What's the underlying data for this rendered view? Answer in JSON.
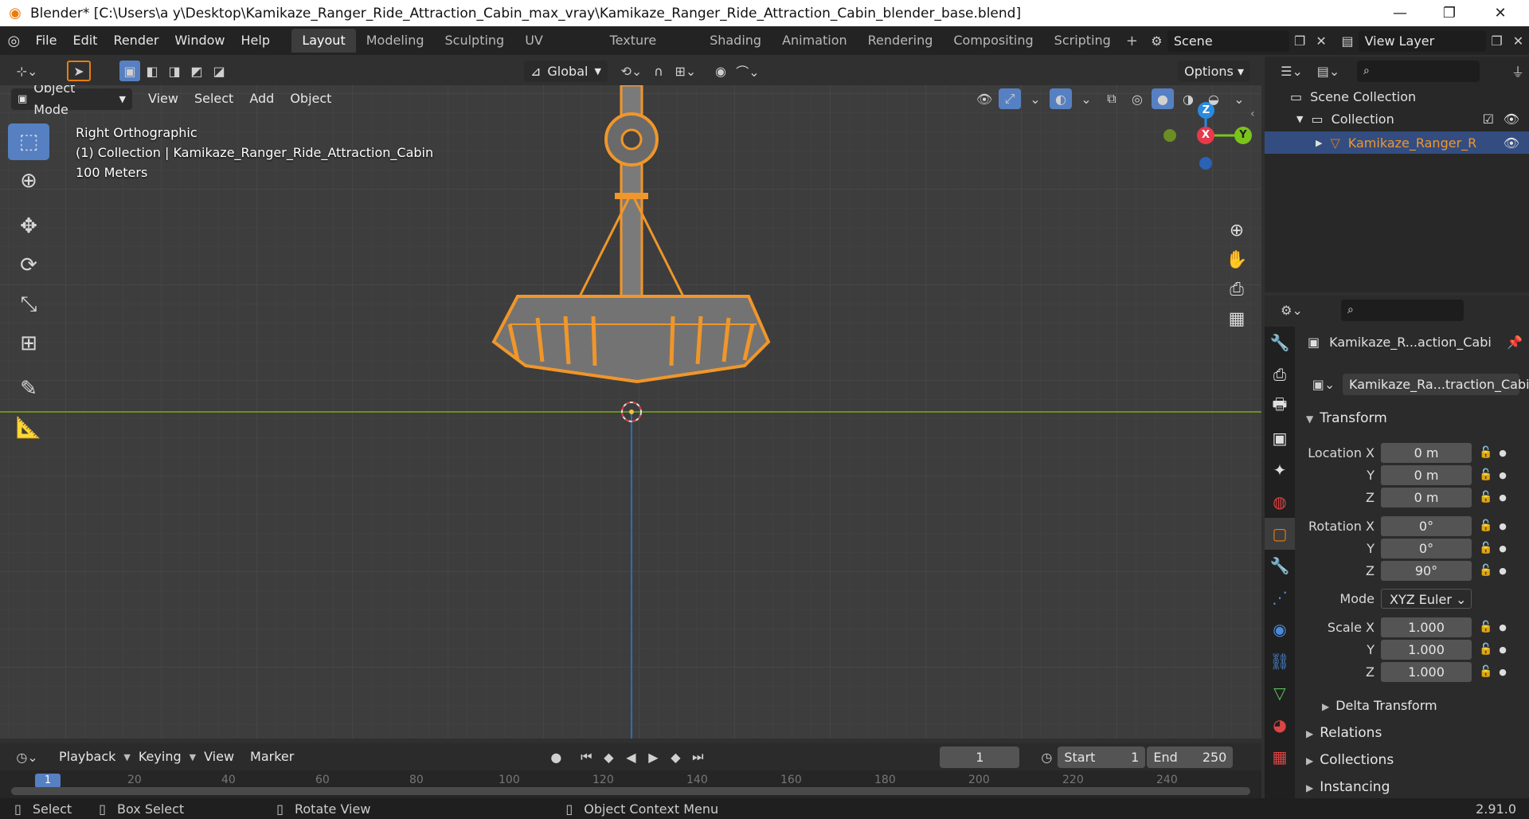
{
  "window": {
    "title": "Blender* [C:\\Users\\a y\\Desktop\\Kamikaze_Ranger_Ride_Attraction_Cabin_max_vray\\Kamikaze_Ranger_Ride_Attraction_Cabin_blender_base.blend]",
    "min": "—",
    "max": "❐",
    "close": "✕"
  },
  "menu": [
    "File",
    "Edit",
    "Render",
    "Window",
    "Help"
  ],
  "workspaces": [
    "Layout",
    "Modeling",
    "Sculpting",
    "UV Editing",
    "Texture Paint",
    "Shading",
    "Animation",
    "Rendering",
    "Compositing",
    "Scripting"
  ],
  "scene": {
    "name": "Scene",
    "view_layer": "View Layer"
  },
  "toolbar": {
    "orientation": "Global",
    "options": "Options"
  },
  "viewport_header": {
    "mode": "Object Mode",
    "menus": [
      "View",
      "Select",
      "Add",
      "Object"
    ]
  },
  "overlay": {
    "view_name": "Right Orthographic",
    "collection_line": "(1) Collection | Kamikaze_Ranger_Ride_Attraction_Cabin",
    "scale": "100 Meters"
  },
  "gizmo": {
    "z": "Z",
    "x": "X",
    "y": "Y"
  },
  "outliner": {
    "root": "Scene Collection",
    "collection": "Collection",
    "object": "Kamikaze_Ranger_R"
  },
  "properties": {
    "object_name": "Kamikaze_R...action_Cabi",
    "data_name": "Kamikaze_Ra...traction_Cabin",
    "transform_label": "Transform",
    "location": {
      "label": "Location X",
      "x": "0 m",
      "y": "0 m",
      "z": "0 m"
    },
    "rotation": {
      "label": "Rotation X",
      "x": "0°",
      "y": "0°",
      "z": "90°"
    },
    "mode": {
      "label": "Mode",
      "value": "XYZ Euler"
    },
    "scale": {
      "label": "Scale X",
      "x": "1.000",
      "y": "1.000",
      "z": "1.000"
    },
    "axis_y": "Y",
    "axis_z": "Z",
    "sections": [
      "Delta Transform",
      "Relations",
      "Collections",
      "Instancing"
    ]
  },
  "timeline": {
    "menus": [
      "Playback",
      "Keying",
      "View",
      "Marker"
    ],
    "current_frame": "1",
    "start_label": "Start",
    "start": "1",
    "end_label": "End",
    "end": "250",
    "ruler": [
      "1",
      "20",
      "40",
      "60",
      "80",
      "100",
      "120",
      "140",
      "160",
      "180",
      "200",
      "220",
      "240"
    ]
  },
  "status": {
    "select": "Select",
    "box_select": "Box Select",
    "rotate": "Rotate View",
    "context": "Object Context Menu",
    "version": "2.91.0"
  },
  "colors": {
    "accent": "#e87d0d",
    "selected_blue": "#5680c2",
    "x_axis": "#e8394a",
    "y_axis": "#7ac41c",
    "z_axis": "#2a8ae0"
  }
}
